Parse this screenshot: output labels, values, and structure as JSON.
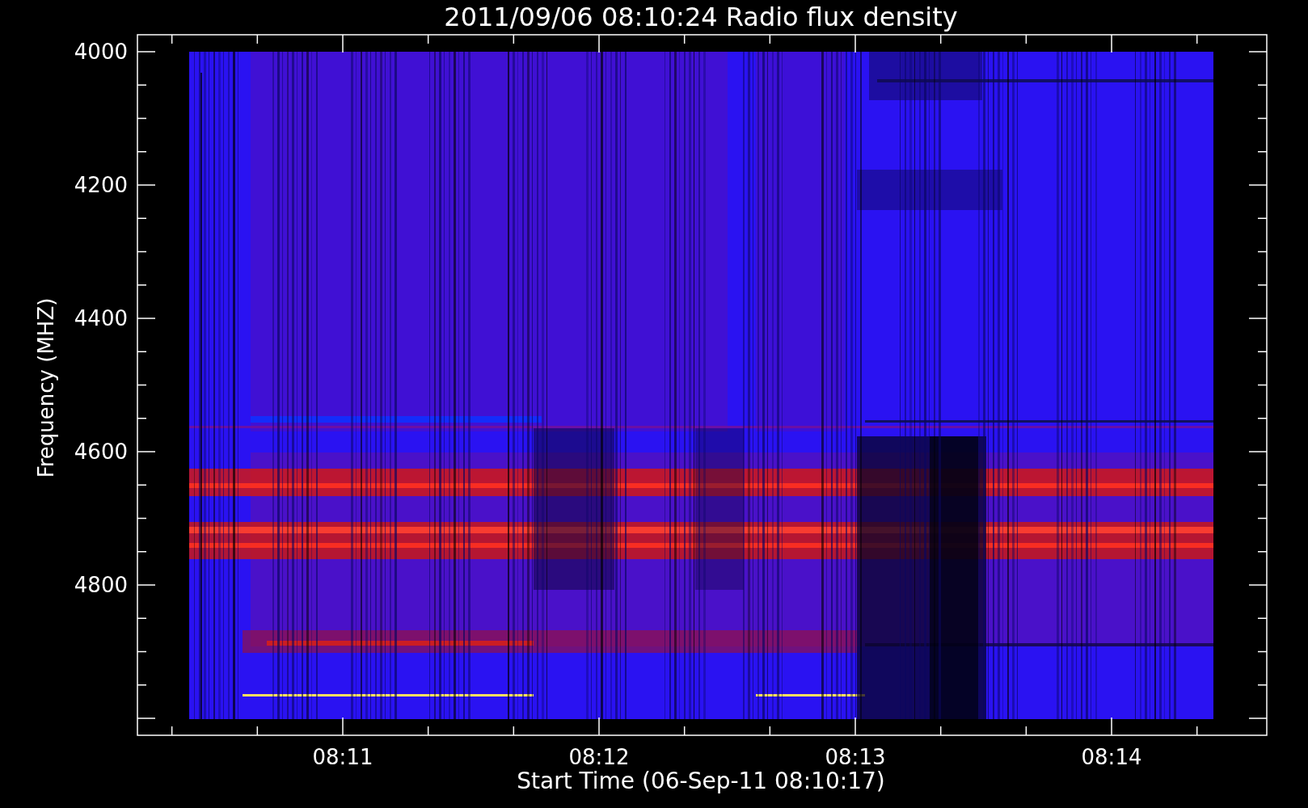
{
  "title": "2011/09/06 08:10:24 Radio flux density",
  "plot": {
    "ylabel": "Frequency (MHZ)",
    "xlabel": "Start Time (06-Sep-11 08:10:17)",
    "yticks": [
      "4000",
      "4200",
      "4400",
      "4600",
      "4800"
    ],
    "xticks": [
      "08:11",
      "08:12",
      "08:13",
      "08:14"
    ]
  }
}
